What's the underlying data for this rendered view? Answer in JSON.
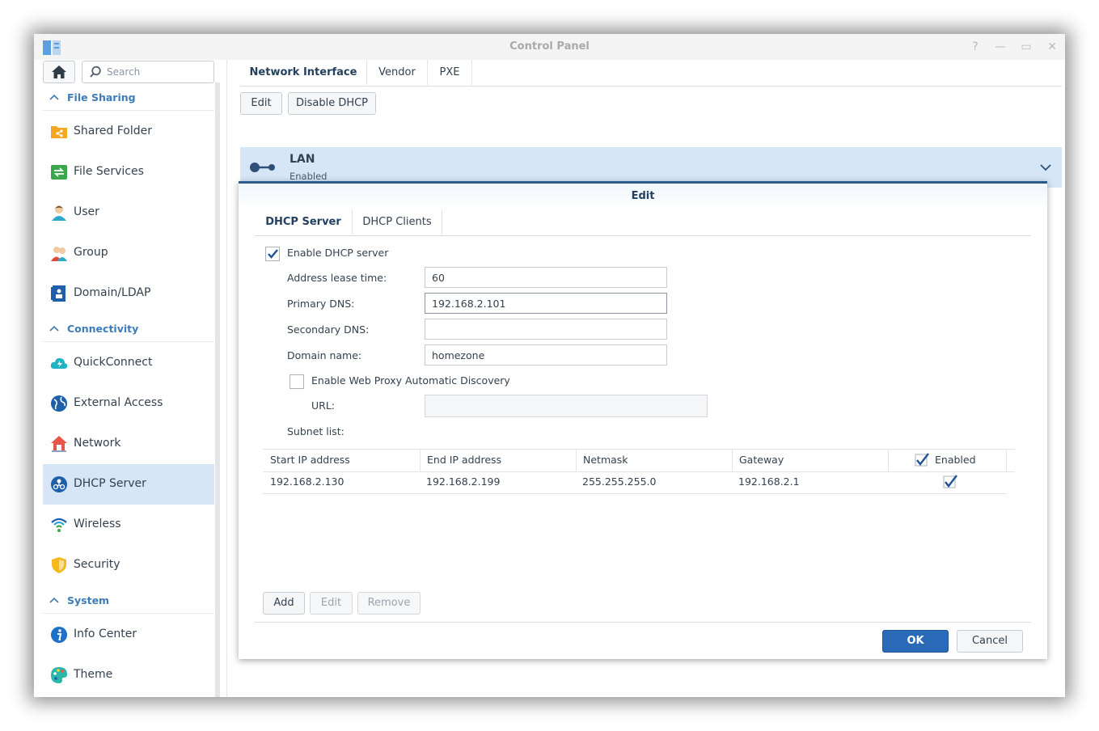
{
  "window": {
    "title": "Control Panel"
  },
  "sidebar": {
    "search_placeholder": "Search",
    "sections": [
      {
        "label": "File Sharing",
        "items": [
          {
            "label": "Shared Folder",
            "icon": "shared-folder-icon"
          },
          {
            "label": "File Services",
            "icon": "file-services-icon"
          },
          {
            "label": "User",
            "icon": "user-icon"
          },
          {
            "label": "Group",
            "icon": "group-icon"
          },
          {
            "label": "Domain/LDAP",
            "icon": "domain-ldap-icon"
          }
        ]
      },
      {
        "label": "Connectivity",
        "items": [
          {
            "label": "QuickConnect",
            "icon": "quickconnect-icon"
          },
          {
            "label": "External Access",
            "icon": "external-access-icon"
          },
          {
            "label": "Network",
            "icon": "network-icon"
          },
          {
            "label": "DHCP Server",
            "icon": "dhcp-server-icon",
            "selected": true
          },
          {
            "label": "Wireless",
            "icon": "wireless-icon"
          },
          {
            "label": "Security",
            "icon": "security-icon"
          }
        ]
      },
      {
        "label": "System",
        "items": [
          {
            "label": "Info Center",
            "icon": "info-center-icon"
          },
          {
            "label": "Theme",
            "icon": "theme-icon"
          }
        ]
      }
    ]
  },
  "main": {
    "tabs": [
      "Network Interface",
      "Vendor",
      "PXE"
    ],
    "active_tab": "Network Interface",
    "toolbar": {
      "edit": "Edit",
      "disable_dhcp": "Disable DHCP"
    },
    "interface": {
      "name": "LAN",
      "status": "Enabled"
    }
  },
  "dialog": {
    "title": "Edit",
    "tabs": [
      "DHCP Server",
      "DHCP Clients"
    ],
    "enable_dhcp_label": "Enable DHCP server",
    "enable_dhcp_checked": true,
    "fields": {
      "lease_label": "Address lease time:",
      "lease_value": "60",
      "primary_dns_label": "Primary DNS:",
      "primary_dns_value": "192.168.2.101",
      "secondary_dns_label": "Secondary DNS:",
      "secondary_dns_value": "",
      "domain_label": "Domain name:",
      "domain_value": "homezone"
    },
    "wpad_label": "Enable Web Proxy Automatic Discovery",
    "wpad_checked": false,
    "url_label": "URL:",
    "url_value": "",
    "subnet_label": "Subnet list:",
    "table": {
      "headers": [
        "Start IP address",
        "End IP address",
        "Netmask",
        "Gateway",
        "Enabled"
      ],
      "rows": [
        {
          "start": "192.168.2.130",
          "end": "192.168.2.199",
          "netmask": "255.255.255.0",
          "gateway": "192.168.2.1",
          "enabled": true
        }
      ]
    },
    "buttons": {
      "add": "Add",
      "edit": "Edit",
      "remove": "Remove",
      "ok": "OK",
      "cancel": "Cancel"
    }
  },
  "colors": {
    "accent": "#2a6ab8",
    "selected_bg": "#d6e6f6",
    "section_label": "#3d7cb8"
  }
}
